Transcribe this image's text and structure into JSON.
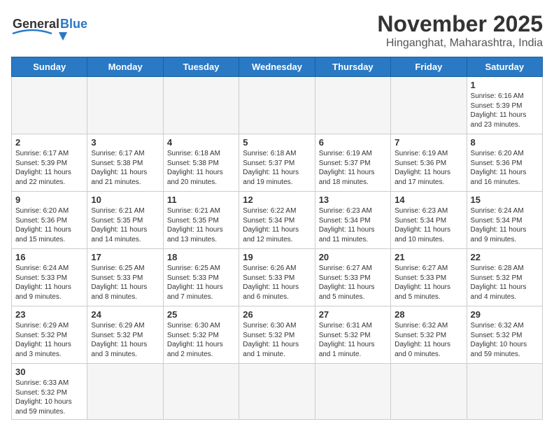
{
  "header": {
    "logo_general": "General",
    "logo_blue": "Blue",
    "month_title": "November 2025",
    "subtitle": "Hinganghat, Maharashtra, India"
  },
  "weekdays": [
    "Sunday",
    "Monday",
    "Tuesday",
    "Wednesday",
    "Thursday",
    "Friday",
    "Saturday"
  ],
  "days": {
    "d1": {
      "num": "1",
      "sunrise": "Sunrise: 6:16 AM",
      "sunset": "Sunset: 5:39 PM",
      "daylight": "Daylight: 11 hours and 23 minutes."
    },
    "d2": {
      "num": "2",
      "sunrise": "Sunrise: 6:17 AM",
      "sunset": "Sunset: 5:39 PM",
      "daylight": "Daylight: 11 hours and 22 minutes."
    },
    "d3": {
      "num": "3",
      "sunrise": "Sunrise: 6:17 AM",
      "sunset": "Sunset: 5:38 PM",
      "daylight": "Daylight: 11 hours and 21 minutes."
    },
    "d4": {
      "num": "4",
      "sunrise": "Sunrise: 6:18 AM",
      "sunset": "Sunset: 5:38 PM",
      "daylight": "Daylight: 11 hours and 20 minutes."
    },
    "d5": {
      "num": "5",
      "sunrise": "Sunrise: 6:18 AM",
      "sunset": "Sunset: 5:37 PM",
      "daylight": "Daylight: 11 hours and 19 minutes."
    },
    "d6": {
      "num": "6",
      "sunrise": "Sunrise: 6:19 AM",
      "sunset": "Sunset: 5:37 PM",
      "daylight": "Daylight: 11 hours and 18 minutes."
    },
    "d7": {
      "num": "7",
      "sunrise": "Sunrise: 6:19 AM",
      "sunset": "Sunset: 5:36 PM",
      "daylight": "Daylight: 11 hours and 17 minutes."
    },
    "d8": {
      "num": "8",
      "sunrise": "Sunrise: 6:20 AM",
      "sunset": "Sunset: 5:36 PM",
      "daylight": "Daylight: 11 hours and 16 minutes."
    },
    "d9": {
      "num": "9",
      "sunrise": "Sunrise: 6:20 AM",
      "sunset": "Sunset: 5:36 PM",
      "daylight": "Daylight: 11 hours and 15 minutes."
    },
    "d10": {
      "num": "10",
      "sunrise": "Sunrise: 6:21 AM",
      "sunset": "Sunset: 5:35 PM",
      "daylight": "Daylight: 11 hours and 14 minutes."
    },
    "d11": {
      "num": "11",
      "sunrise": "Sunrise: 6:21 AM",
      "sunset": "Sunset: 5:35 PM",
      "daylight": "Daylight: 11 hours and 13 minutes."
    },
    "d12": {
      "num": "12",
      "sunrise": "Sunrise: 6:22 AM",
      "sunset": "Sunset: 5:34 PM",
      "daylight": "Daylight: 11 hours and 12 minutes."
    },
    "d13": {
      "num": "13",
      "sunrise": "Sunrise: 6:23 AM",
      "sunset": "Sunset: 5:34 PM",
      "daylight": "Daylight: 11 hours and 11 minutes."
    },
    "d14": {
      "num": "14",
      "sunrise": "Sunrise: 6:23 AM",
      "sunset": "Sunset: 5:34 PM",
      "daylight": "Daylight: 11 hours and 10 minutes."
    },
    "d15": {
      "num": "15",
      "sunrise": "Sunrise: 6:24 AM",
      "sunset": "Sunset: 5:34 PM",
      "daylight": "Daylight: 11 hours and 9 minutes."
    },
    "d16": {
      "num": "16",
      "sunrise": "Sunrise: 6:24 AM",
      "sunset": "Sunset: 5:33 PM",
      "daylight": "Daylight: 11 hours and 9 minutes."
    },
    "d17": {
      "num": "17",
      "sunrise": "Sunrise: 6:25 AM",
      "sunset": "Sunset: 5:33 PM",
      "daylight": "Daylight: 11 hours and 8 minutes."
    },
    "d18": {
      "num": "18",
      "sunrise": "Sunrise: 6:25 AM",
      "sunset": "Sunset: 5:33 PM",
      "daylight": "Daylight: 11 hours and 7 minutes."
    },
    "d19": {
      "num": "19",
      "sunrise": "Sunrise: 6:26 AM",
      "sunset": "Sunset: 5:33 PM",
      "daylight": "Daylight: 11 hours and 6 minutes."
    },
    "d20": {
      "num": "20",
      "sunrise": "Sunrise: 6:27 AM",
      "sunset": "Sunset: 5:33 PM",
      "daylight": "Daylight: 11 hours and 5 minutes."
    },
    "d21": {
      "num": "21",
      "sunrise": "Sunrise: 6:27 AM",
      "sunset": "Sunset: 5:33 PM",
      "daylight": "Daylight: 11 hours and 5 minutes."
    },
    "d22": {
      "num": "22",
      "sunrise": "Sunrise: 6:28 AM",
      "sunset": "Sunset: 5:32 PM",
      "daylight": "Daylight: 11 hours and 4 minutes."
    },
    "d23": {
      "num": "23",
      "sunrise": "Sunrise: 6:29 AM",
      "sunset": "Sunset: 5:32 PM",
      "daylight": "Daylight: 11 hours and 3 minutes."
    },
    "d24": {
      "num": "24",
      "sunrise": "Sunrise: 6:29 AM",
      "sunset": "Sunset: 5:32 PM",
      "daylight": "Daylight: 11 hours and 3 minutes."
    },
    "d25": {
      "num": "25",
      "sunrise": "Sunrise: 6:30 AM",
      "sunset": "Sunset: 5:32 PM",
      "daylight": "Daylight: 11 hours and 2 minutes."
    },
    "d26": {
      "num": "26",
      "sunrise": "Sunrise: 6:30 AM",
      "sunset": "Sunset: 5:32 PM",
      "daylight": "Daylight: 11 hours and 1 minute."
    },
    "d27": {
      "num": "27",
      "sunrise": "Sunrise: 6:31 AM",
      "sunset": "Sunset: 5:32 PM",
      "daylight": "Daylight: 11 hours and 1 minute."
    },
    "d28": {
      "num": "28",
      "sunrise": "Sunrise: 6:32 AM",
      "sunset": "Sunset: 5:32 PM",
      "daylight": "Daylight: 11 hours and 0 minutes."
    },
    "d29": {
      "num": "29",
      "sunrise": "Sunrise: 6:32 AM",
      "sunset": "Sunset: 5:32 PM",
      "daylight": "Daylight: 10 hours and 59 minutes."
    },
    "d30": {
      "num": "30",
      "sunrise": "Sunrise: 6:33 AM",
      "sunset": "Sunset: 5:32 PM",
      "daylight": "Daylight: 10 hours and 59 minutes."
    }
  }
}
